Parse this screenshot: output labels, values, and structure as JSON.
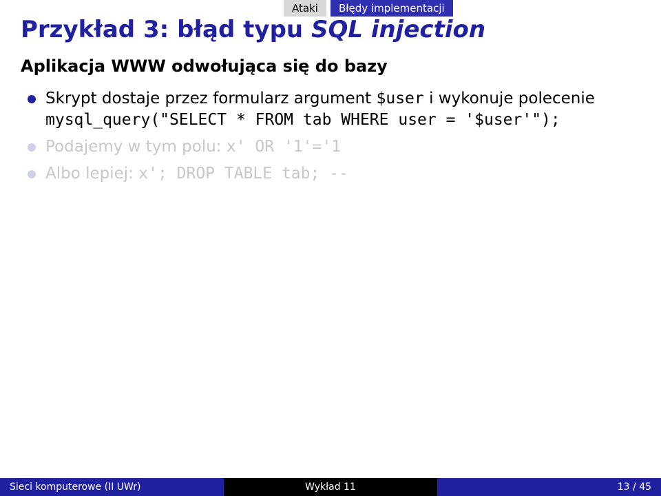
{
  "nav": {
    "section": "Ataki",
    "subsection": "Błędy implementacji"
  },
  "title": {
    "prefix": "Przykład 3: błąd typu ",
    "italic": "SQL injection"
  },
  "subtitle": "Aplikacja WWW odwołująca się do bazy",
  "items": [
    {
      "dim": false,
      "parts": [
        {
          "kind": "text",
          "value": "Skrypt dostaje przez formularz argument "
        },
        {
          "kind": "mono",
          "value": "$user"
        },
        {
          "kind": "text",
          "value": " i wykonuje polecenie "
        },
        {
          "kind": "mono",
          "value": "mysql_query(\"SELECT * FROM tab WHERE user = '$user'\");"
        }
      ]
    },
    {
      "dim": true,
      "parts": [
        {
          "kind": "text",
          "value": "Podajemy w tym polu: "
        },
        {
          "kind": "mono",
          "value": "x' OR '1'='1"
        }
      ]
    },
    {
      "dim": true,
      "parts": [
        {
          "kind": "text",
          "value": "Albo lepiej: "
        },
        {
          "kind": "mono",
          "value": "x'; DROP TABLE tab; --"
        }
      ]
    }
  ],
  "footer": {
    "left": "Sieci komputerowe (II UWr)",
    "center": "Wykład 11",
    "right": "13 / 45"
  }
}
